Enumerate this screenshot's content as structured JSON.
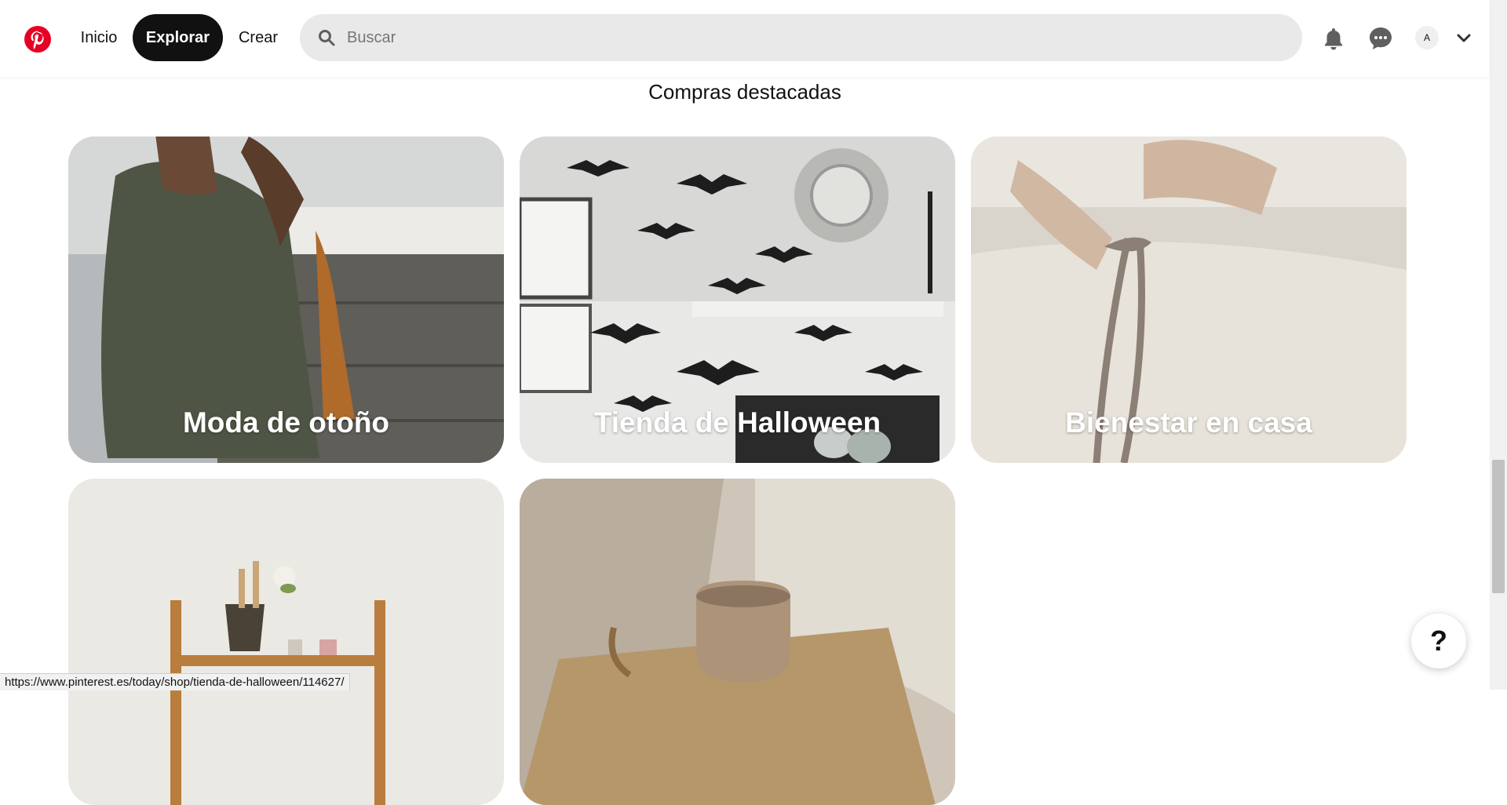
{
  "header": {
    "logo_icon": "pinterest-logo",
    "nav": {
      "home_label": "Inicio",
      "explore_label": "Explorar",
      "create_label": "Crear"
    },
    "search": {
      "placeholder": "Buscar",
      "value": ""
    },
    "notifications_icon": "bell-icon",
    "messages_icon": "chat-icon",
    "avatar_initial": "A",
    "account_menu_icon": "chevron-down-icon"
  },
  "section": {
    "title": "Compras destacadas",
    "cards": [
      {
        "label": "Moda de otoño"
      },
      {
        "label": "Tienda de Halloween"
      },
      {
        "label": "Bienestar en casa"
      },
      {
        "label": ""
      },
      {
        "label": ""
      }
    ]
  },
  "help": {
    "label": "?"
  },
  "status_bar": {
    "url": "https://www.pinterest.es/today/shop/tienda-de-halloween/114627/"
  },
  "colors": {
    "brand": "#E60023",
    "active_nav_bg": "#111111",
    "search_bg": "#E9E9E9"
  }
}
